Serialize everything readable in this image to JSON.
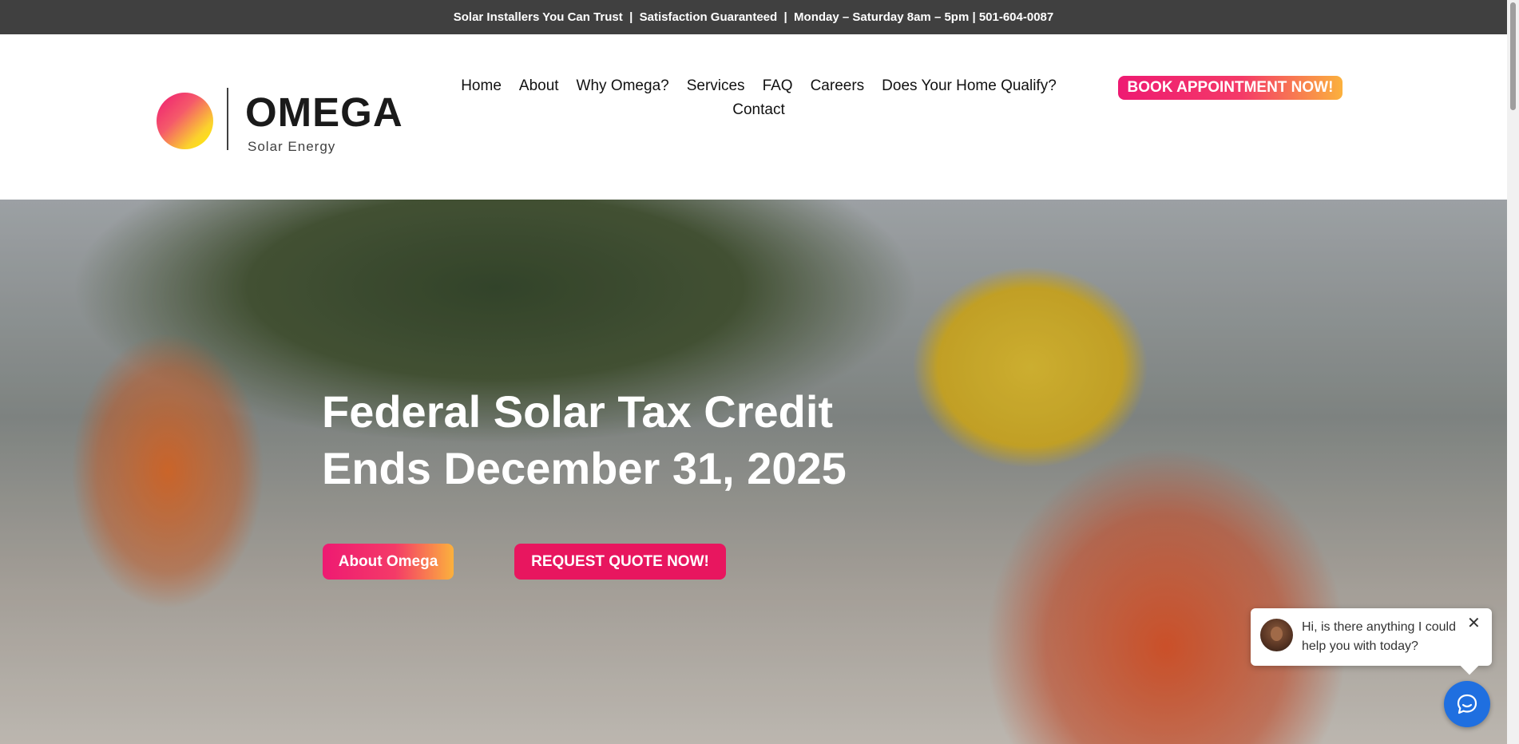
{
  "topbar": {
    "tagline": "Solar Installers You Can Trust",
    "sep1": "  |  ",
    "guarantee": "Satisfaction Guaranteed",
    "sep2": "  |  ",
    "hours_phone": "Monday – Saturday 8am – 5pm | 501-604-0087"
  },
  "logo": {
    "name": "OMEGA",
    "subtitle": "Solar Energy"
  },
  "nav": {
    "items": [
      "Home",
      "About",
      "Why Omega?",
      "Services",
      "FAQ",
      "Careers",
      "Does Your Home Qualify?",
      "Contact"
    ]
  },
  "header": {
    "book_label": "BOOK APPOINTMENT NOW!"
  },
  "hero": {
    "title_line1": "Federal Solar Tax Credit",
    "title_line2": "Ends December 31, 2025",
    "about_label": "About Omega",
    "quote_label": "REQUEST QUOTE NOW!"
  },
  "chat": {
    "message": "Hi, is there anything I could help you with today?",
    "close": "✕"
  },
  "colors": {
    "brand_pink": "#ee1a72",
    "brand_yellow": "#fbb13d",
    "chat_blue": "#1f6fe0",
    "topbar_bg": "#404040"
  }
}
